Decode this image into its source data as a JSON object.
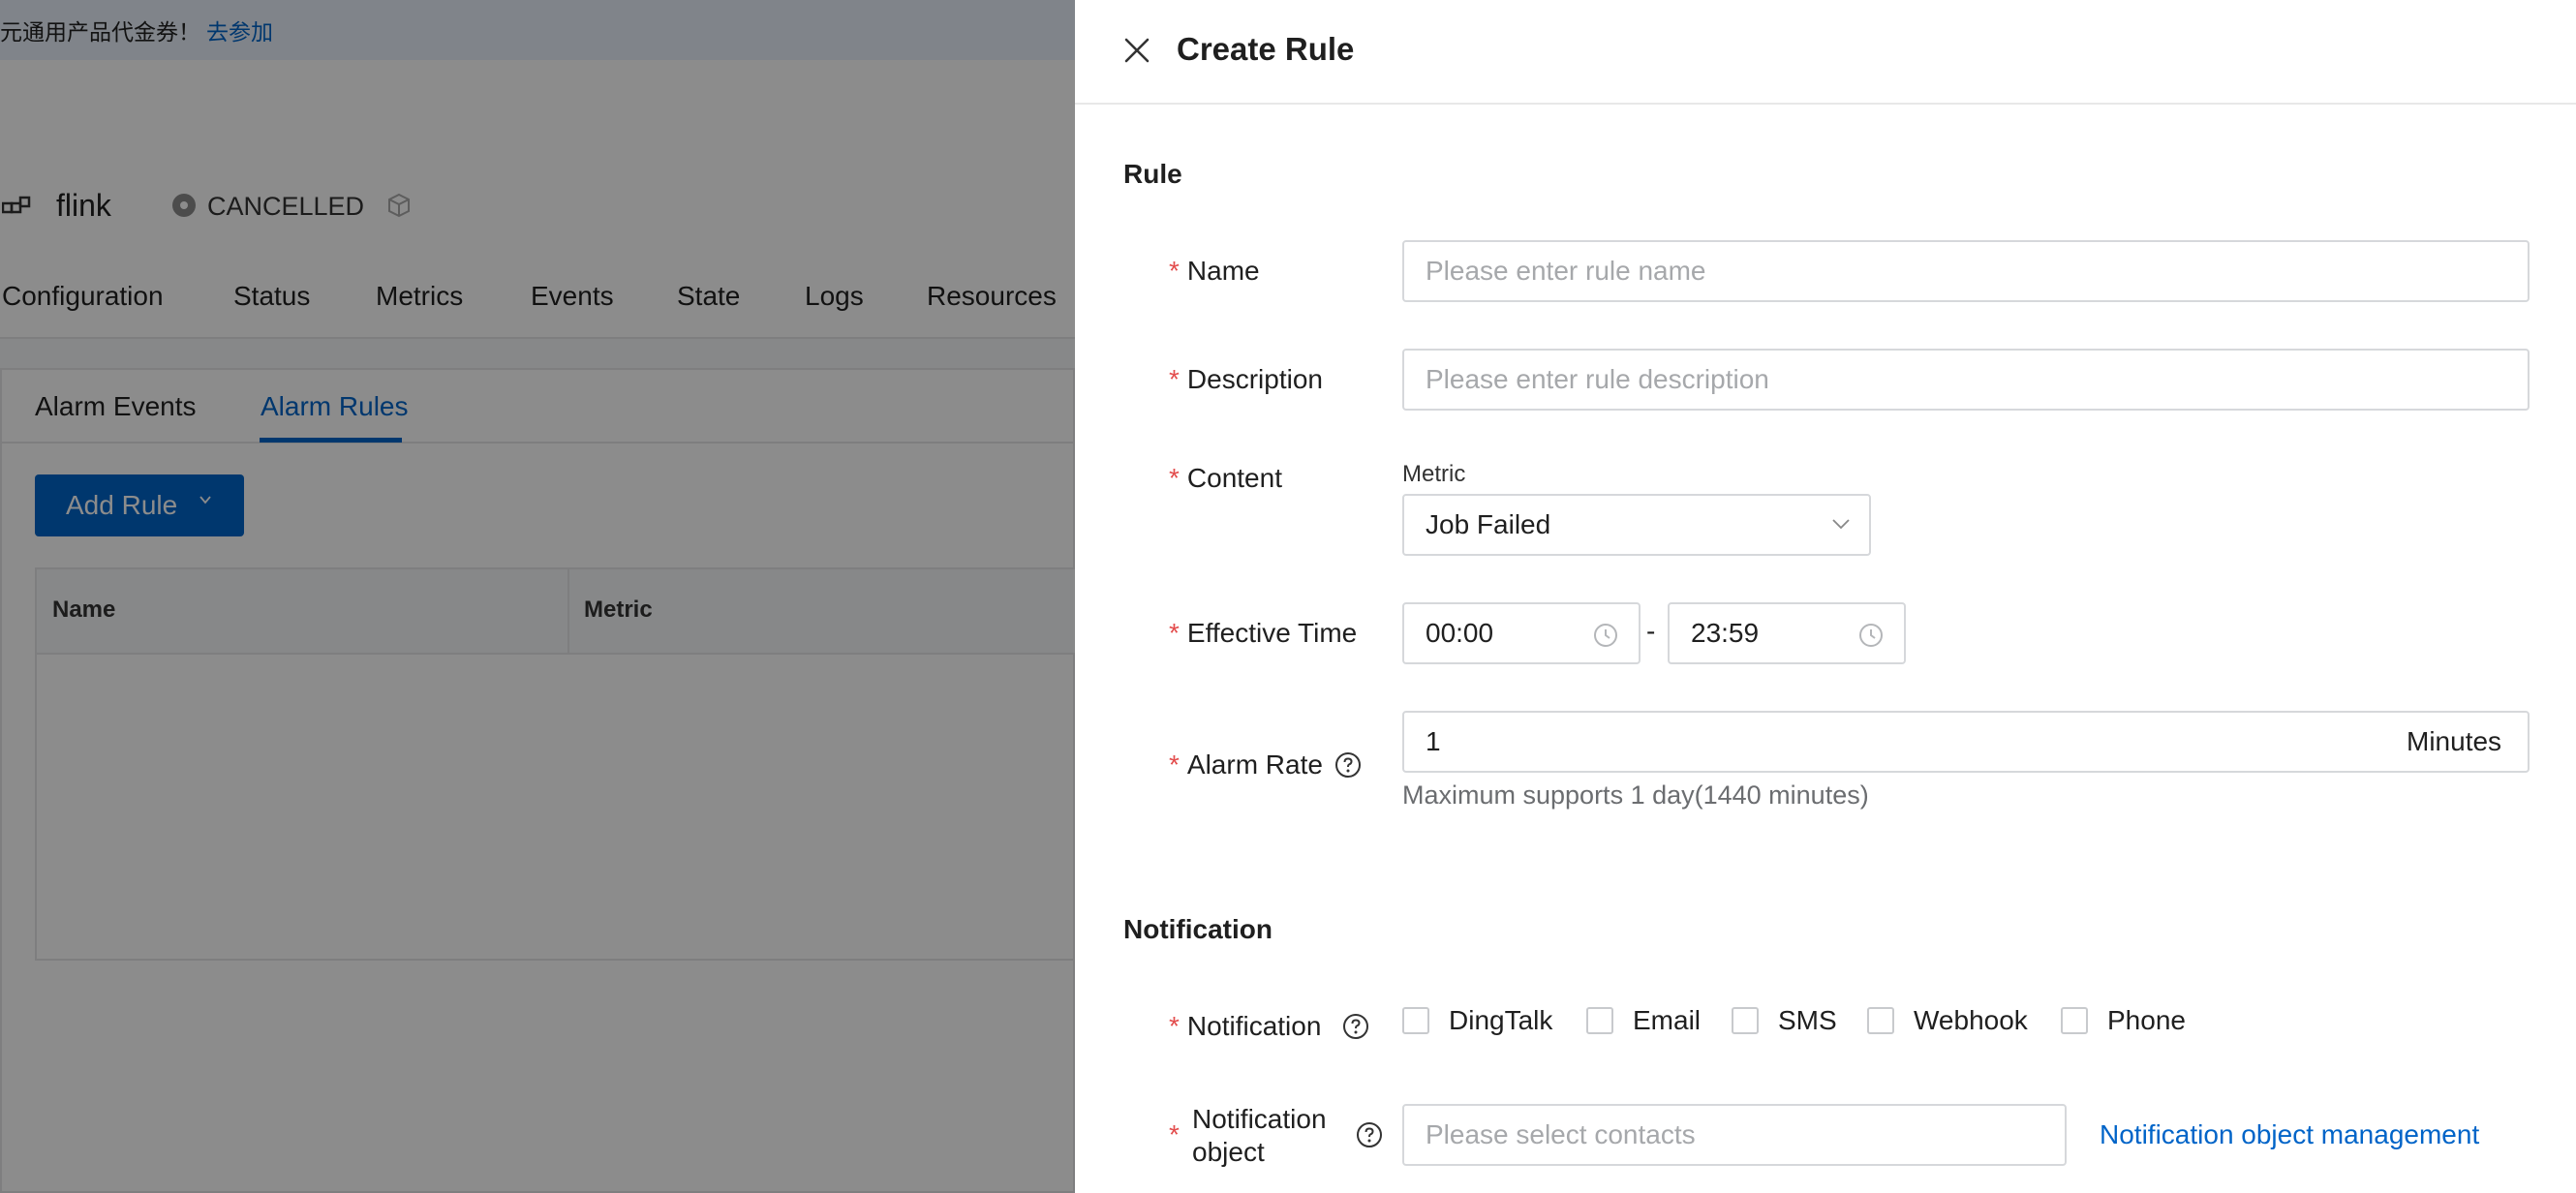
{
  "banner": {
    "text": "元通用产品代金券！",
    "link": "去参加"
  },
  "job": {
    "name": "flink",
    "status": "CANCELLED"
  },
  "nav": [
    "Configuration",
    "Status",
    "Metrics",
    "Events",
    "State",
    "Logs",
    "Resources"
  ],
  "sub_tabs": {
    "items": [
      "Alarm Events",
      "Alarm Rules"
    ],
    "active": "Alarm Rules"
  },
  "add_rule_label": "Add Rule",
  "table": {
    "columns": [
      "Name",
      "Metric"
    ]
  },
  "drawer": {
    "title": "Create Rule",
    "rule_section": "Rule",
    "name": {
      "label": "Name",
      "placeholder": "Please enter rule name"
    },
    "description": {
      "label": "Description",
      "placeholder": "Please enter rule description"
    },
    "content": {
      "label": "Content",
      "metric_label": "Metric",
      "metric_value": "Job Failed"
    },
    "effective_time": {
      "label": "Effective Time",
      "start": "00:00",
      "separator": "-",
      "end": "23:59"
    },
    "alarm_rate": {
      "label": "Alarm Rate",
      "value": "1",
      "unit": "Minutes",
      "hint": "Maximum supports 1 day(1440 minutes)"
    },
    "notification_section": "Notification",
    "notification": {
      "label": "Notification",
      "channels": [
        "DingTalk",
        "Email",
        "SMS",
        "Webhook",
        "Phone"
      ]
    },
    "notification_object": {
      "label_line1": "Notification",
      "label_line2": "object",
      "placeholder": "Please select contacts",
      "manage_link": "Notification object management"
    }
  },
  "colors": {
    "accent": "#0064c8",
    "required": "#e34d4d",
    "overlay": "rgba(0,0,0,0.45)"
  }
}
